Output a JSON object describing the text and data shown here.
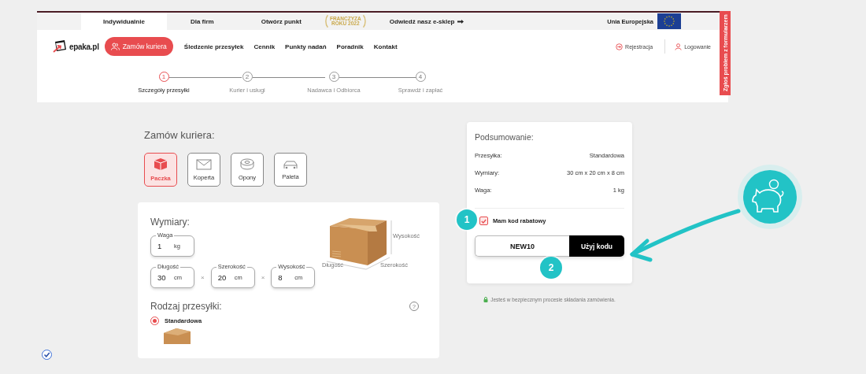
{
  "top_bar": {
    "tabs": [
      {
        "label": "Indywidualnie",
        "selected": true,
        "kind": "plain"
      },
      {
        "label": "Dla firm",
        "selected": false,
        "kind": "plain"
      },
      {
        "label": "Otwórz punkt",
        "selected": false,
        "kind": "award",
        "badge": "FRANCZYZA ROKU 2022"
      },
      {
        "label": "Odwiedź nasz e-sklep",
        "selected": false,
        "kind": "shop"
      }
    ],
    "region": "Unia Europejska"
  },
  "nav": {
    "logo": "epaka.pl",
    "cta": "Zamów kuriera",
    "links": [
      "Śledzenie przesyłek",
      "Cennik",
      "Punkty nadań",
      "Poradnik",
      "Kontakt"
    ],
    "account": [
      {
        "label": "Rejestracja",
        "kind": "register"
      },
      {
        "label": "Logowanie",
        "kind": "login"
      }
    ]
  },
  "steps": [
    {
      "number": "1",
      "label": "Szczegóły przesyłki",
      "selected": true
    },
    {
      "number": "2",
      "label": "Kurier i usługi",
      "selected": false
    },
    {
      "number": "3",
      "label": "Nadawca i Odbiorca",
      "selected": false
    },
    {
      "number": "4",
      "label": "Sprawdź i zapłać",
      "selected": false
    }
  ],
  "feedback_tab": "Zgłoś problem z formularzem",
  "order": {
    "title": "Zamów kuriera:",
    "types": [
      {
        "label": "Paczka",
        "kind": "parcel",
        "selected": true
      },
      {
        "label": "Koperta",
        "kind": "envelope",
        "selected": false
      },
      {
        "label": "Opony",
        "kind": "tires",
        "selected": false
      },
      {
        "label": "Paleta",
        "kind": "pallet",
        "selected": false
      }
    ]
  },
  "dimensions": {
    "title": "Wymiary:",
    "weight": {
      "label": "Waga",
      "value": "1",
      "unit": "kg"
    },
    "sizes": [
      {
        "label": "Długość",
        "value": "30",
        "unit": "cm"
      },
      {
        "label": "Szerokość",
        "value": "20",
        "unit": "cm"
      },
      {
        "label": "Wysokość",
        "value": "8",
        "unit": "cm"
      }
    ],
    "separators": [
      "×",
      "×"
    ],
    "diagram_labels": {
      "height": "Wysokość",
      "length": "Długość",
      "width": "Szerokość"
    }
  },
  "shipment_type": {
    "title": "Rodzaj przesyłki:",
    "help": "?",
    "options": [
      {
        "label": "Standardowa",
        "selected": true
      }
    ]
  },
  "summary": {
    "title": "Podsumowanie:",
    "rows": [
      {
        "label": "Przesyłka:",
        "value": "Standardowa"
      },
      {
        "label": "Wymiary:",
        "value": "30 cm x 20 cm x 8 cm"
      },
      {
        "label": "Waga:",
        "value": "1 kg"
      }
    ],
    "discount": {
      "label": "Mam kod rabatowy",
      "checked": true
    },
    "code": {
      "value": "NEW10"
    },
    "apply_button": "Użyj kodu"
  },
  "secure_note": "Jesteś w bezpiecznym procesie składania zamówienia.",
  "callouts": [
    "1",
    "2"
  ]
}
